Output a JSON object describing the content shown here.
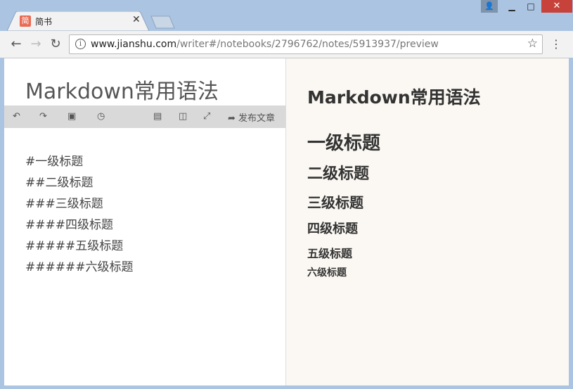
{
  "browser": {
    "tab_title": "简书",
    "favicon_text": "简",
    "url_host": "www.jianshu.com",
    "url_path": "/writer#/notebooks/2796762/notes/5913937/preview"
  },
  "editor": {
    "title": "Markdown常用语法",
    "publish_label": "发布文章",
    "lines": [
      "#一级标题",
      "##二级标题",
      "###三级标题",
      "####四级标题",
      "#####五级标题",
      "######六级标题"
    ]
  },
  "preview": {
    "title": "Markdown常用语法",
    "h1": "一级标题",
    "h2": "二级标题",
    "h3": "三级标题",
    "h4": "四级标题",
    "h5": "五级标题",
    "h6": "六级标题"
  },
  "colors": {
    "window_frame": "#aac4e2",
    "favicon": "#e96b55",
    "preview_bg": "#fbf8f3"
  }
}
